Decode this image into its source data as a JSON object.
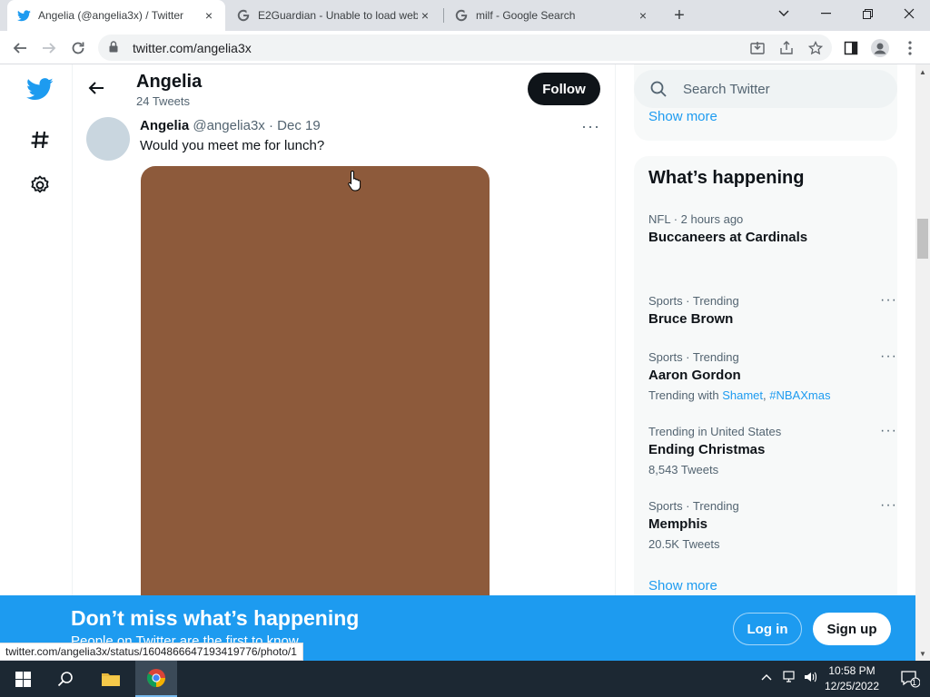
{
  "browser": {
    "tabs": [
      {
        "title": "Angelia (@angelia3x) / Twitter",
        "close": "×"
      },
      {
        "title": "E2Guardian - Unable to load web",
        "close": "×"
      },
      {
        "title": "milf - Google Search",
        "close": "×"
      }
    ],
    "new_tab": "+",
    "url": "twitter.com/angelia3x",
    "status_url": "twitter.com/angelia3x/status/1604866647193419776/photo/1"
  },
  "profile": {
    "name": "Angelia",
    "tweet_count": "24 Tweets",
    "follow_label": "Follow"
  },
  "tweet": {
    "name": "Angelia",
    "handle": "@angelia3x",
    "sep": "·",
    "date": "Dec 19",
    "text": "Would you meet me for lunch?",
    "more": "···",
    "image_color": "#8d5a3b"
  },
  "sidebar": {
    "search_placeholder": "Search Twitter",
    "show_more_top": "Show more",
    "happening_title": "What’s happening",
    "trends": [
      {
        "meta": "NFL · 2 hours ago",
        "name": "Buccaneers at Cardinals"
      },
      {
        "meta": "Sports · Trending",
        "name": "Bruce Brown"
      },
      {
        "meta": "Sports · Trending",
        "name": "Aaron Gordon",
        "trending_with": "Trending with",
        "tag1": "Shamet",
        "comma": ",",
        "tag2": "#NBAXmas"
      },
      {
        "meta": "Trending in United States",
        "name": "Ending Christmas",
        "count": "8,543 Tweets"
      },
      {
        "meta": "Sports · Trending",
        "name": "Memphis",
        "count": "20.5K Tweets"
      }
    ],
    "show_more_bottom": "Show more"
  },
  "banner": {
    "title": "Don’t miss what’s happening",
    "subtitle": "People on Twitter are the first to know.",
    "login": "Log in",
    "signup": "Sign up"
  },
  "taskbar": {
    "time": "10:58 PM",
    "date": "12/25/2022",
    "notif_count": "1"
  },
  "colors": {
    "twitter_blue": "#1d9bf0",
    "follow_bg": "#0f1419",
    "taskbar": "#1c2833"
  }
}
